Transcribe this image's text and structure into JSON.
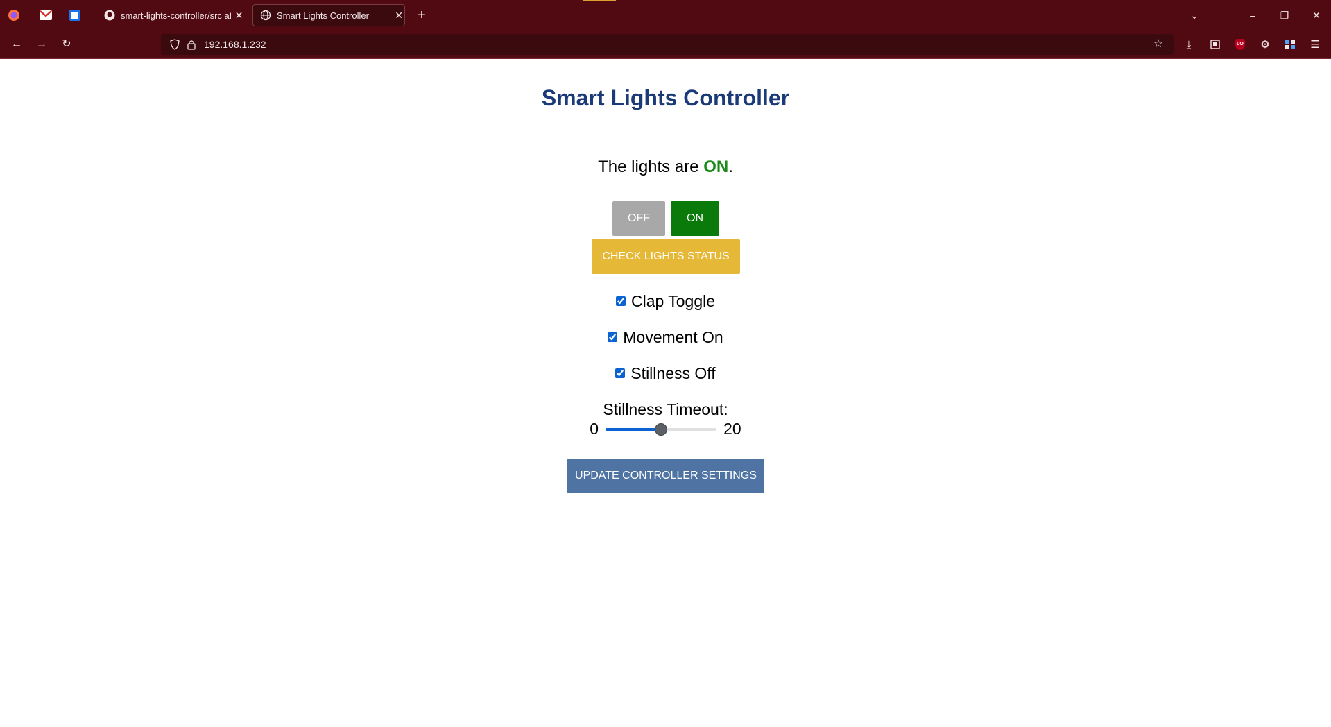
{
  "browser": {
    "tabs": [
      {
        "title": "smart-lights-controller/src at m",
        "icon": "github-icon",
        "active": false
      },
      {
        "title": "Smart Lights Controller",
        "icon": "globe-icon",
        "active": true
      }
    ],
    "url": "192.168.1.232",
    "accent_color": "#520a12"
  },
  "app": {
    "title": "Smart Lights Controller",
    "status_prefix": "The lights are ",
    "status_state": "ON",
    "status_suffix": ".",
    "buttons": {
      "off": "OFF",
      "on": "ON",
      "check": "CHECK LIGHTS STATUS",
      "update": "UPDATE CONTROLLER SETTINGS"
    },
    "options": [
      {
        "label": "Clap Toggle",
        "checked": true
      },
      {
        "label": "Movement On",
        "checked": true
      },
      {
        "label": "Stillness Off",
        "checked": true
      }
    ],
    "timeout": {
      "label": "Stillness Timeout:",
      "min": "0",
      "max": "20",
      "value": 10
    },
    "colors": {
      "title": "#1b3a78",
      "on_state": "#1a8a1a",
      "off_button": "#a8a8a8",
      "on_button": "#0a7a0a",
      "check_button": "#e6b838",
      "update_button": "#4f74a3"
    }
  }
}
